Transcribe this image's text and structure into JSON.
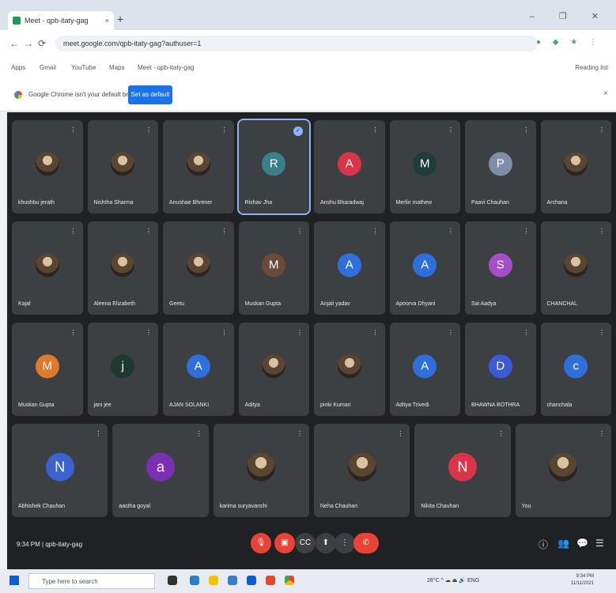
{
  "browser": {
    "tab_title": "Meet - qpb-itaty-gag",
    "tab_close": "×",
    "new_tab": "+",
    "window_controls": "– ❐ ✕",
    "url": "meet.google.com/qpb-itaty-gag?authuser=1",
    "bookmarks": [
      "Apps",
      "Gmail",
      "YouTube",
      "Maps",
      "Meet - qpb-itaty-gag"
    ],
    "reading_list": "Reading list",
    "infobar_message": "Google Chrome isn't your default browser",
    "infobar_button": "Set as default",
    "infobar_close": "×"
  },
  "meeting": {
    "time": "9:34 PM",
    "code": "qpb-itaty-gag",
    "participants_rows": [
      [
        {
          "name": "khushbu jerath",
          "initial": "",
          "color": "photo"
        },
        {
          "name": "Nishtha Sharma",
          "initial": "",
          "color": "photo"
        },
        {
          "name": "Anushae Bhrener",
          "initial": "",
          "color": "photo"
        },
        {
          "name": "Rishav Jha",
          "initial": "R",
          "color": "#3a7f8a",
          "active": true
        },
        {
          "name": "Anshu Bharadwaj",
          "initial": "A",
          "color": "#d93448"
        },
        {
          "name": "Merlin mathew",
          "initial": "M",
          "color": "#1f3b3a"
        },
        {
          "name": "Paavi Chauhan",
          "initial": "P",
          "color": "#7d8ea6"
        },
        {
          "name": "Archana",
          "initial": "",
          "color": "photo"
        }
      ],
      [
        {
          "name": "Kajal",
          "initial": "",
          "color": "photo"
        },
        {
          "name": "Aleena Elizabeth",
          "initial": "",
          "color": "photo"
        },
        {
          "name": "Geetu",
          "initial": "",
          "color": "photo"
        },
        {
          "name": "Muskan Gupta",
          "initial": "M",
          "color": "#6b4a3a"
        },
        {
          "name": "Anjali yadav",
          "initial": "A",
          "color": "#2f6fdc"
        },
        {
          "name": "Apoorva Dhyani",
          "initial": "A",
          "color": "#2f6fdc"
        },
        {
          "name": "Sai Aadya",
          "initial": "S",
          "color": "#a64dc9"
        },
        {
          "name": "CHANCHAL",
          "initial": "",
          "color": "photo"
        }
      ],
      [
        {
          "name": "Muskan Gupta",
          "initial": "M",
          "color": "#e0792a"
        },
        {
          "name": "jani jee",
          "initial": "j",
          "color": "#1c3a30"
        },
        {
          "name": "AJAN SOLANKI",
          "initial": "A",
          "color": "#2f6fdc"
        },
        {
          "name": "Aditya",
          "initial": "",
          "color": "photo"
        },
        {
          "name": "pinki Kumari",
          "initial": "",
          "color": "photo"
        },
        {
          "name": "Aditya Trivedi",
          "initial": "A",
          "color": "#2f6fdc"
        },
        {
          "name": "BHAWNA BOTHRA",
          "initial": "D",
          "color": "#3b5bd6"
        },
        {
          "name": "chanchala",
          "initial": "c",
          "color": "#2f6fdc"
        }
      ],
      [
        {
          "name": "Abhishek Chauhan",
          "initial": "N",
          "color": "#3b63d0"
        },
        {
          "name": "aastha goyal",
          "initial": "a",
          "color": "#7b2fb5"
        },
        {
          "name": "karima suryavanshi",
          "initial": "",
          "color": "photo"
        },
        {
          "name": "Neha Chauhan",
          "initial": "",
          "color": "photo"
        },
        {
          "name": "Nikita Chauhan",
          "initial": "N",
          "color": "#d93448"
        },
        {
          "name": "You",
          "initial": "",
          "color": "photo"
        }
      ]
    ],
    "more_icon": "⋮",
    "pin_icon": "✓",
    "controls": {
      "mic": "🎙",
      "camera": "▣",
      "captions": "CC",
      "present": "⬆",
      "more": "⋮",
      "hangup": "✆"
    },
    "side": {
      "info": "ⓘ",
      "people": "👥",
      "chat": "💬",
      "activities": "☰"
    }
  },
  "taskbar": {
    "search_placeholder": "Type here to search",
    "weather": "28°C",
    "tray_text": "ENG",
    "time": "9:34 PM",
    "date": "11/11/2021"
  }
}
